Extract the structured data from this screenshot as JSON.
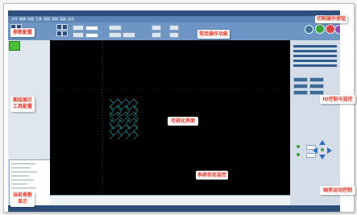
{
  "menu": {
    "items": [
      "文件",
      "编辑",
      "绘图",
      "工具",
      "视图",
      "帮助",
      "高级",
      "语言"
    ]
  },
  "toolbar": {
    "tool_icons": [
      "file-open-icon",
      "save-icon",
      "undo-icon",
      "redo-icon",
      "select-icon",
      "line-icon",
      "arc-icon",
      "rect-icon"
    ],
    "round_buttons": [
      {
        "name": "start-cut-button",
        "color": "#3ea336"
      },
      {
        "name": "pause-button",
        "color": "#d64545"
      },
      {
        "name": "stop-button",
        "color": "#8b4cb3"
      }
    ]
  },
  "status_labels": [
    "",
    "",
    ""
  ],
  "callouts": {
    "params": "参数配置",
    "common_ops": "常用操作功能",
    "cut_buttons": "切割操作按钮",
    "layer_tools_1": "图层展示",
    "layer_tools_2": "工具配置",
    "io_control": "IO控制与监控",
    "visual": "可视化界面",
    "current_params_1": "当前参数",
    "current_params_2": "显示",
    "status_monitor": "系统状态监控",
    "axis_control": "轴类运动控制"
  }
}
